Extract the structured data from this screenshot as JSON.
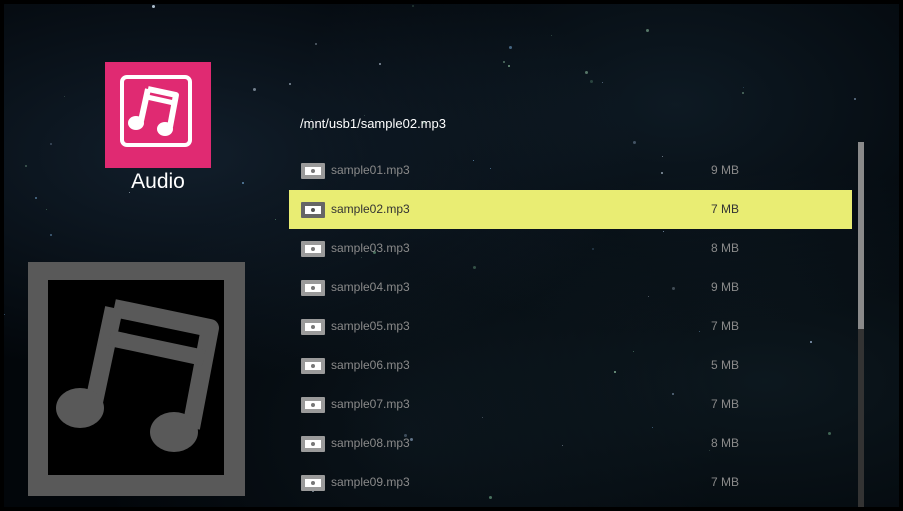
{
  "app": {
    "label": "Audio",
    "icon": "music-note-icon",
    "accent": "#e02a72"
  },
  "preview": {
    "icon": "music-note-icon"
  },
  "path": "/mnt/usb1/sample02.mp3",
  "files": [
    {
      "name": "sample01.mp3",
      "size": "9  MB"
    },
    {
      "name": "sample02.mp3",
      "size": "7  MB",
      "selected": true
    },
    {
      "name": "sample03.mp3",
      "size": "8  MB"
    },
    {
      "name": "sample04.mp3",
      "size": "9  MB"
    },
    {
      "name": "sample05.mp3",
      "size": "7  MB"
    },
    {
      "name": "sample06.mp3",
      "size": "5  MB"
    },
    {
      "name": "sample07.mp3",
      "size": "7  MB"
    },
    {
      "name": "sample08.mp3",
      "size": "8  MB"
    },
    {
      "name": "sample09.mp3",
      "size": "7  MB"
    }
  ],
  "colors": {
    "highlight": "#e9ed73",
    "text_dim": "#8a8a8a",
    "text_selected": "#333333"
  }
}
